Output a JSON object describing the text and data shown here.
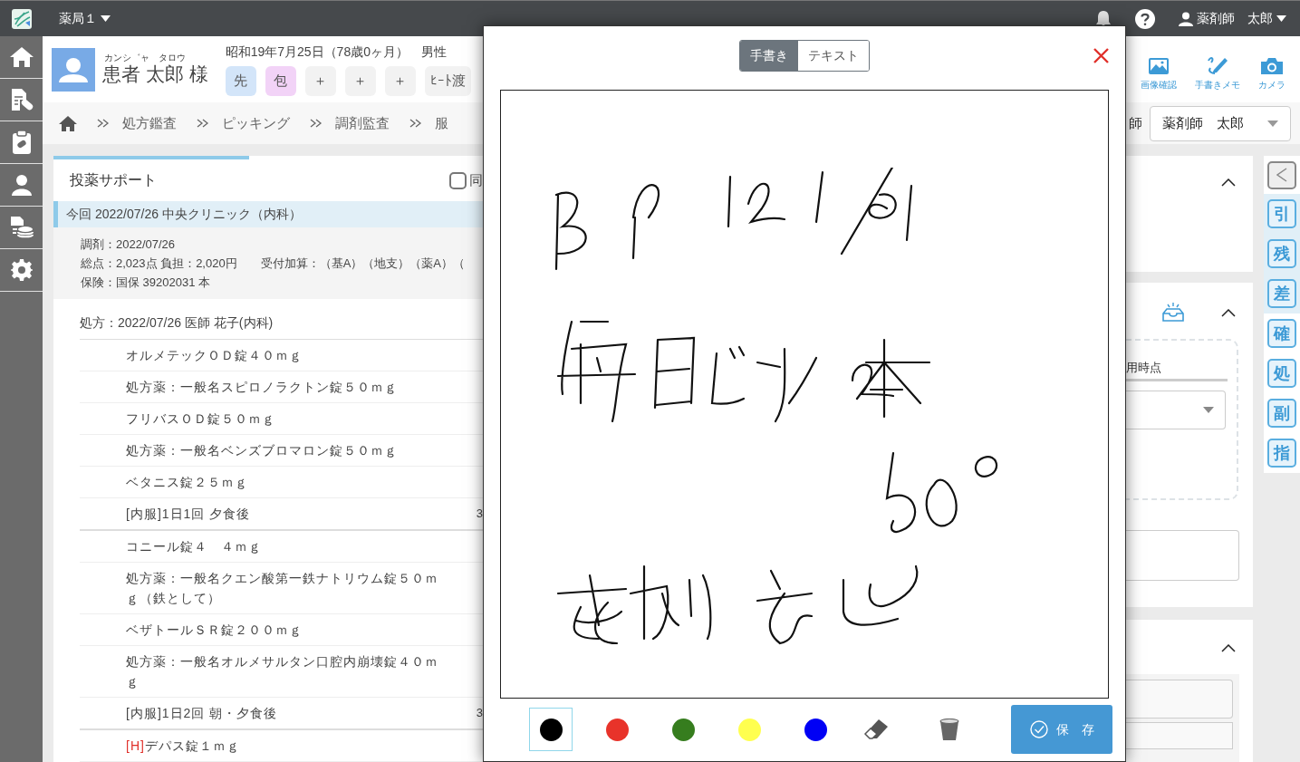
{
  "topbar": {
    "store": "薬局１",
    "user": "薬剤師　太郎"
  },
  "patient": {
    "kana": "カンシ゛ャ　タロウ",
    "name": "患者 太郎 様",
    "birth": "昭和19年7月25日（78歳0ヶ月）",
    "sex": "男性",
    "tags": [
      {
        "label": "先",
        "color": "#d3e5f9"
      },
      {
        "label": "包",
        "color": "#f2d3f7"
      },
      {
        "label": "＋",
        "color": "#f2f2f2"
      },
      {
        "label": "＋",
        "color": "#f2f2f2"
      },
      {
        "label": "＋",
        "color": "#f2f2f2"
      },
      {
        "label": "ﾋｰﾄ渡",
        "color": "#f2f2f2"
      }
    ]
  },
  "breadcrumb": [
    "処方鑑査",
    "ピッキング",
    "調剤監査",
    "服"
  ],
  "tools": [
    {
      "kind": "image",
      "label": "画像確認"
    },
    {
      "kind": "pen",
      "label": "手書きメモ"
    },
    {
      "kind": "camera",
      "label": "カメラ"
    }
  ],
  "pharmacist": {
    "label": "師",
    "value": "薬剤師　太郎"
  },
  "support": {
    "title": "投薬サポート",
    "checkbox_label": "同",
    "checked": false,
    "visit": "今回 2022/07/26 中央クリニック（内科）",
    "details": [
      "調剤：2022/07/26",
      "総点：2,023点 負担：2,020円　　受付加算：（基A）（地支）（薬A）（",
      "保険：国保 39202031 本"
    ],
    "prescription": "処方：2022/07/26 医師 花子(内科)",
    "items": [
      {
        "kind": "drug",
        "text": "オルメテックＯＤ錠４０ｍｇ"
      },
      {
        "kind": "drug",
        "text": "処方薬：一般名スピロノラクトン錠５０ｍｇ"
      },
      {
        "kind": "drug",
        "text": "フリバスＯＤ錠５０ｍｇ"
      },
      {
        "kind": "drug",
        "text": "処方薬：一般名ベンズブロマロン錠５０ｍｇ"
      },
      {
        "kind": "drug",
        "text": "ベタニス錠２５ｍｇ"
      },
      {
        "kind": "usage",
        "text": "[内服]1日1回 夕食後",
        "column_2": "3"
      },
      {
        "kind": "drug",
        "text": "コニール錠４　４ｍｇ"
      },
      {
        "kind": "drug",
        "text": "処方薬：一般名クエン酸第一鉄ナトリウム錠５０ｍｇ（鉄として）"
      },
      {
        "kind": "drug",
        "text": "ベザトールＳＲ錠２００ｍｇ"
      },
      {
        "kind": "drug",
        "text": "処方薬：一般名オルメサルタン口腔内崩壊錠４０ｍｇ"
      },
      {
        "kind": "usage",
        "text": "[内服]1日2回 朝・夕食後",
        "column_2": "3"
      },
      {
        "kind": "drug",
        "flag": "[H]",
        "text": "デパス錠１ｍｇ"
      }
    ]
  },
  "right_panel": {
    "field_label": "用時点"
  },
  "side_buttons": [
    {
      "label": "引",
      "highlighted": true
    },
    {
      "label": "残",
      "highlighted": true
    },
    {
      "label": "差",
      "highlighted": true
    },
    {
      "label": "確",
      "highlighted": false
    },
    {
      "label": "処",
      "highlighted": false
    },
    {
      "label": "副",
      "highlighted": false
    },
    {
      "label": "指",
      "highlighted": false
    }
  ],
  "modal": {
    "modes": [
      {
        "label": "手書き",
        "selected": true
      },
      {
        "label": "テキスト",
        "selected": false
      }
    ],
    "pen_colors": [
      {
        "color": "#000000",
        "selected": true
      },
      {
        "color": "#e8332a",
        "selected": false
      },
      {
        "color": "#367d1e",
        "selected": false
      },
      {
        "color": "#ffff4f",
        "selected": false
      },
      {
        "color": "#0000f5",
        "selected": false
      }
    ],
    "save": "保　存"
  }
}
